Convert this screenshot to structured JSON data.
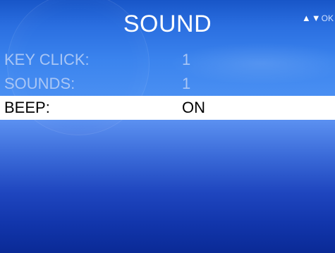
{
  "title": "SOUND",
  "nav_hint": {
    "up_icon": "▲",
    "down_icon": "▼",
    "ok": "OK"
  },
  "menu": {
    "items": [
      {
        "label": "KEY CLICK:",
        "value": "1",
        "selected": false
      },
      {
        "label": "SOUNDS:",
        "value": "1",
        "selected": false
      },
      {
        "label": "BEEP:",
        "value": "ON",
        "selected": true
      }
    ]
  },
  "colors": {
    "item_text": "#a9c6f5",
    "selected_bg": "#ffffff",
    "selected_text": "#000000",
    "title_text": "#ffffff"
  }
}
